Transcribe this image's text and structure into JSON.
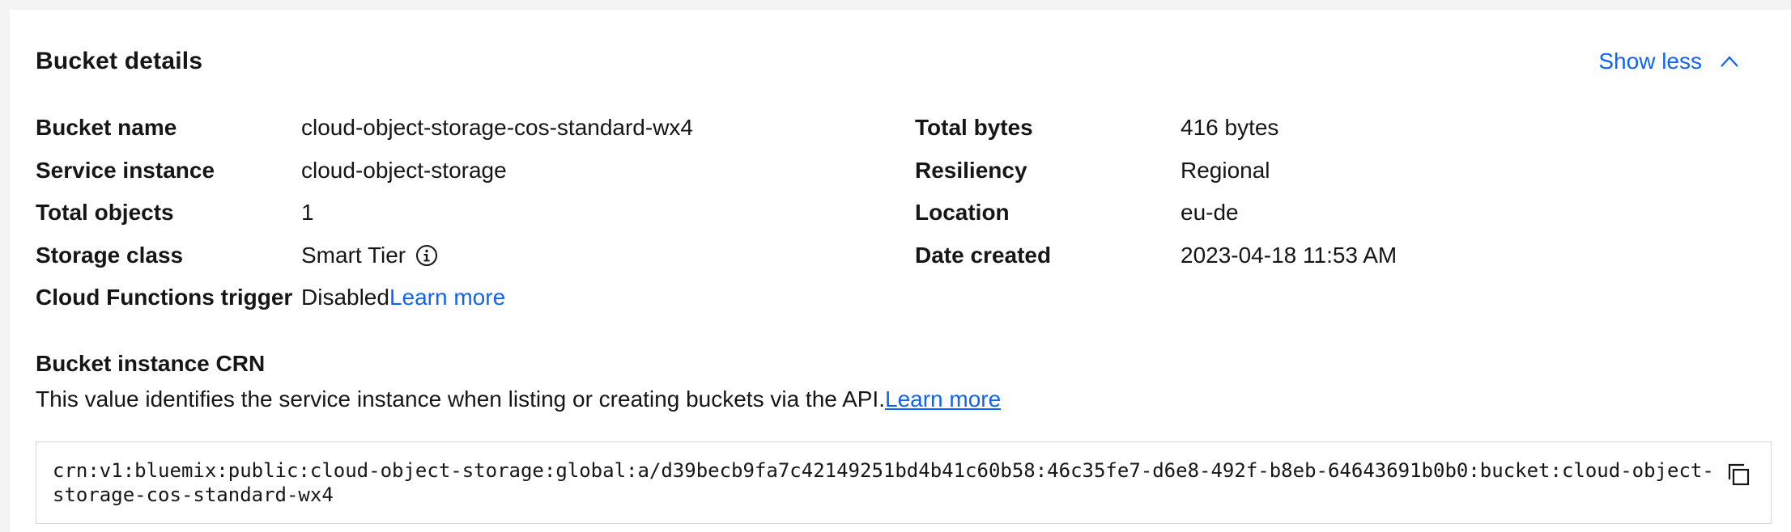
{
  "header": {
    "title": "Bucket details",
    "toggle_label": "Show less"
  },
  "details": {
    "left": [
      {
        "label": "Bucket name",
        "value": "cloud-object-storage-cos-standard-wx4"
      },
      {
        "label": "Service instance",
        "value": "cloud-object-storage"
      },
      {
        "label": "Total objects",
        "value": "1"
      },
      {
        "label": "Storage class",
        "value": "Smart Tier"
      },
      {
        "label": "Cloud Functions trigger",
        "value": "Disabled",
        "link": "Learn more"
      }
    ],
    "right": [
      {
        "label": "Total bytes",
        "value": "416 bytes"
      },
      {
        "label": "Resiliency",
        "value": "Regional"
      },
      {
        "label": "Location",
        "value": "eu-de"
      },
      {
        "label": "Date created",
        "value": "2023-04-18 11:53 AM"
      }
    ]
  },
  "crn": {
    "title": "Bucket instance CRN",
    "description": "This value identifies the service instance when listing or creating buckets via the API.",
    "link": "Learn more",
    "value": "crn:v1:bluemix:public:cloud-object-storage:global:a/d39becb9fa7c42149251bd4b41c60b58:46c35fe7-d6e8-492f-b8eb-64643691b0b0:bucket:cloud-object-storage-cos-standard-wx4"
  },
  "icons": {
    "toggle": "chevron-up-icon",
    "storage_class_info": "information-icon",
    "copy": "copy-icon"
  },
  "colors": {
    "link": "#0f62fe",
    "text": "#161616",
    "background": "#f4f4f4",
    "panel": "#ffffff",
    "border": "#d8d8d8"
  }
}
